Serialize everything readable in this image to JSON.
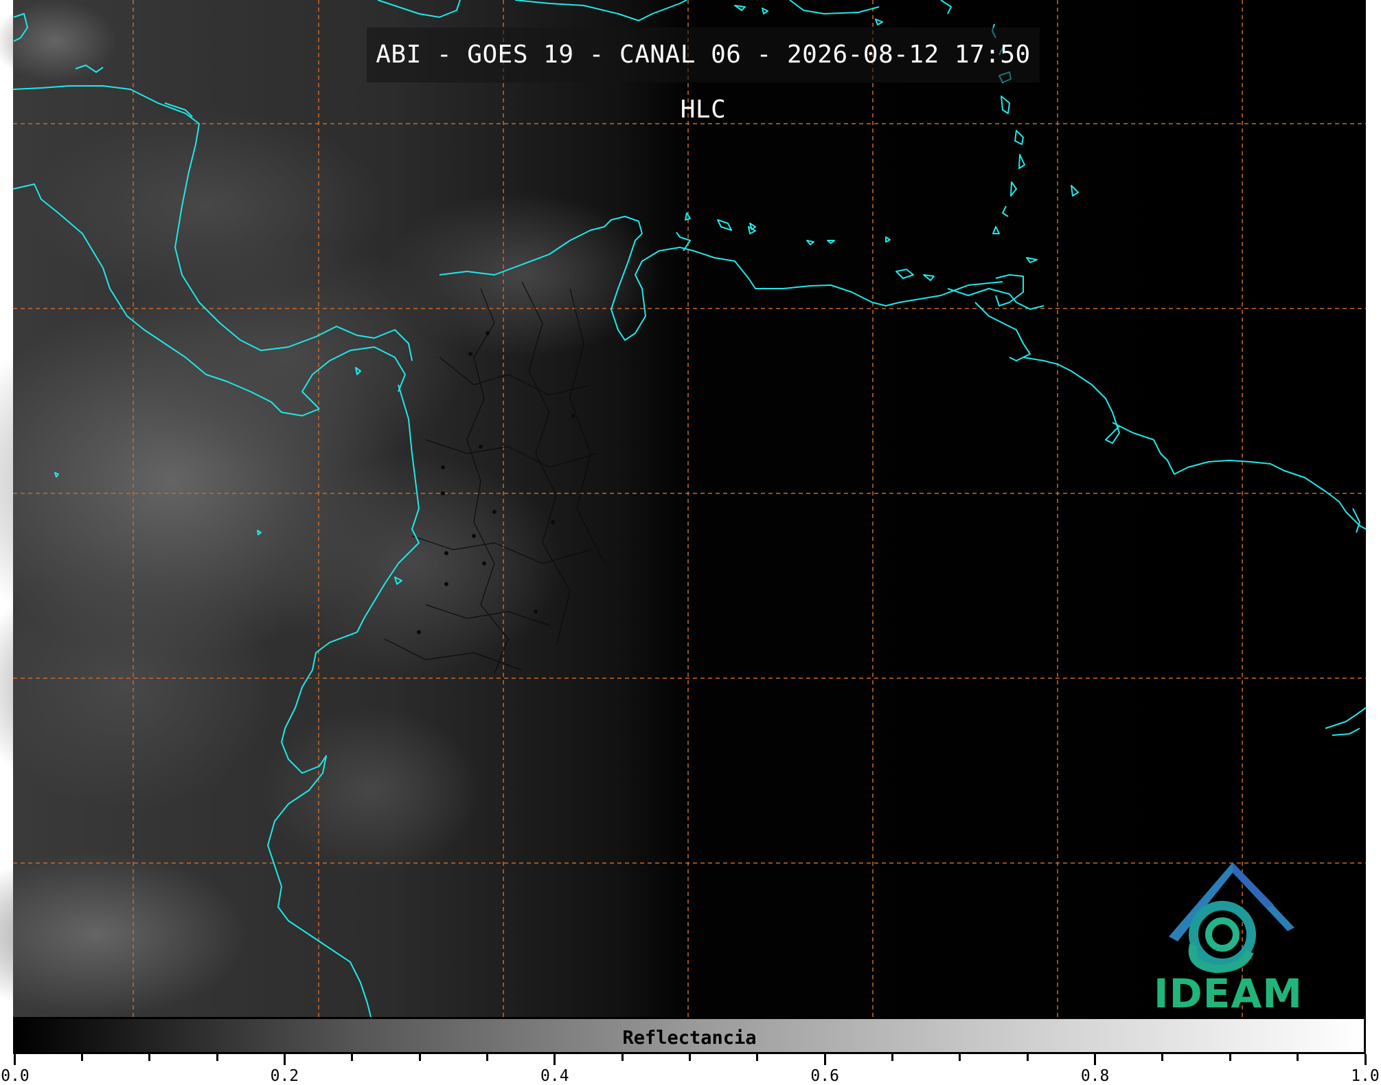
{
  "title": "ABI - GOES 19 - CANAL 06 - 2026-08-12 17:50 HLC",
  "logo": {
    "text": "IDEAM",
    "icon": "ideam-logo-icon",
    "color": "#20b57a"
  },
  "colorbar": {
    "label": "Reflectancia",
    "range": [
      0.0,
      1.0
    ],
    "ticks": [
      "0.0",
      "0.2",
      "0.4",
      "0.6",
      "0.8",
      "1.0"
    ],
    "colormap": "grayscale black-to-white"
  },
  "map": {
    "gridline_color": "#c86a28",
    "coastline_color": "#20e8e8",
    "border_color": "#000000",
    "background": "#000000"
  }
}
